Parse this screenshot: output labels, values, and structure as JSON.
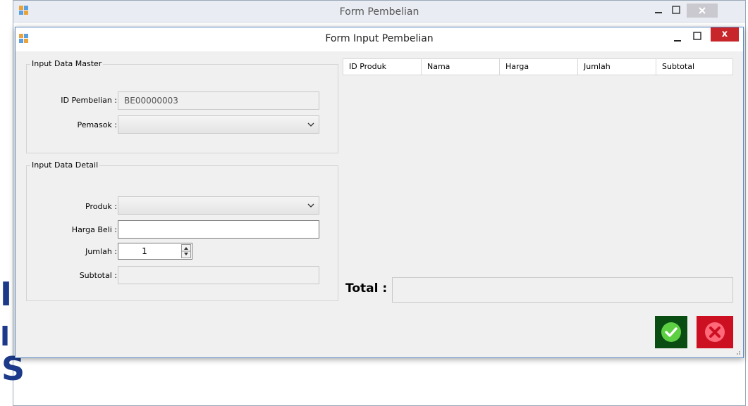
{
  "background_window": {
    "title": "Form Pembelian"
  },
  "background_letters": [
    "I",
    "I",
    "S"
  ],
  "dialog": {
    "title": "Form Input Pembelian",
    "close_glyph": "x"
  },
  "master_group": {
    "legend": "Input Data Master",
    "id_label": "ID Pembelian :",
    "id_value": "BE00000003",
    "supplier_label": "Pemasok :",
    "supplier_value": ""
  },
  "detail_group": {
    "legend": "Input Data Detail",
    "product_label": "Produk :",
    "product_value": "",
    "price_label": "Harga Beli :",
    "price_value": "",
    "qty_label": "Jumlah :",
    "qty_value": "1",
    "subtotal_label": "Subtotal :",
    "subtotal_value": ""
  },
  "grid": {
    "columns": [
      "ID Produk",
      "Nama",
      "Harga",
      "Jumlah",
      "Subtotal"
    ],
    "rows": []
  },
  "total": {
    "label": "Total :",
    "value": ""
  },
  "buttons": {
    "ok_icon": "check-icon",
    "cancel_icon": "cancel-x-icon"
  },
  "colors": {
    "ok": "#0a4d13",
    "cancel": "#cc1022",
    "close": "#c7262a",
    "title_blue": "#1d3a8a"
  }
}
